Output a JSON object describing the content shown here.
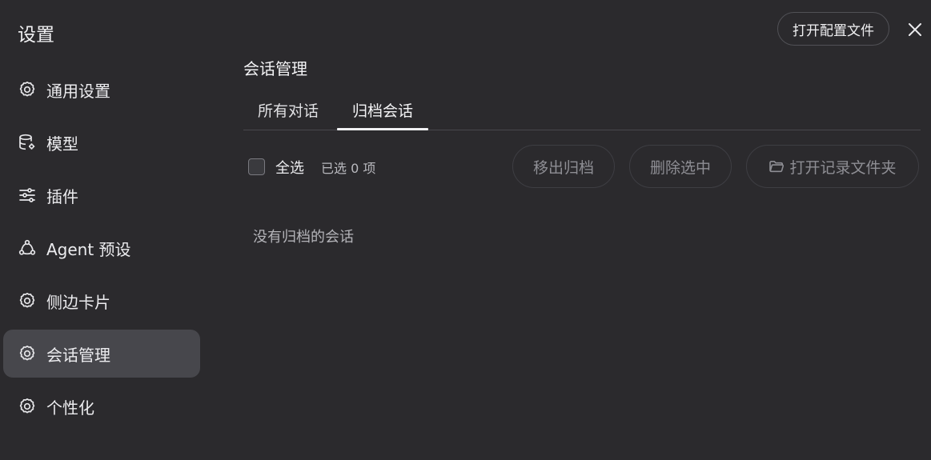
{
  "app": {
    "title": "设置"
  },
  "sidebar": {
    "items": [
      {
        "label": "通用设置",
        "icon": "gear-icon",
        "active": false
      },
      {
        "label": "模型",
        "icon": "database-gear-icon",
        "active": false
      },
      {
        "label": "插件",
        "icon": "sliders-icon",
        "active": false
      },
      {
        "label": "Agent 预设",
        "icon": "agent-network-icon",
        "active": false
      },
      {
        "label": "侧边卡片",
        "icon": "gear-icon",
        "active": false
      },
      {
        "label": "会话管理",
        "icon": "gear-icon",
        "active": true
      },
      {
        "label": "个性化",
        "icon": "gear-icon",
        "active": false
      }
    ]
  },
  "header": {
    "open_config_label": "打开配置文件",
    "close_icon": "close-icon"
  },
  "main": {
    "section_title": "会话管理",
    "tabs": [
      {
        "label": "所有对话",
        "active": false
      },
      {
        "label": "归档会话",
        "active": true
      }
    ],
    "toolbar": {
      "select_all_label": "全选",
      "selected_count": "已选 0 项",
      "unarchive_label": "移出归档",
      "delete_label": "删除选中",
      "open_folder_label": "打开记录文件夹"
    },
    "empty_message": "没有归档的会话"
  },
  "colors": {
    "background": "#2b2a2d",
    "active_item": "#47474c",
    "text_primary": "#ececef",
    "text_muted": "#8e8e94"
  }
}
